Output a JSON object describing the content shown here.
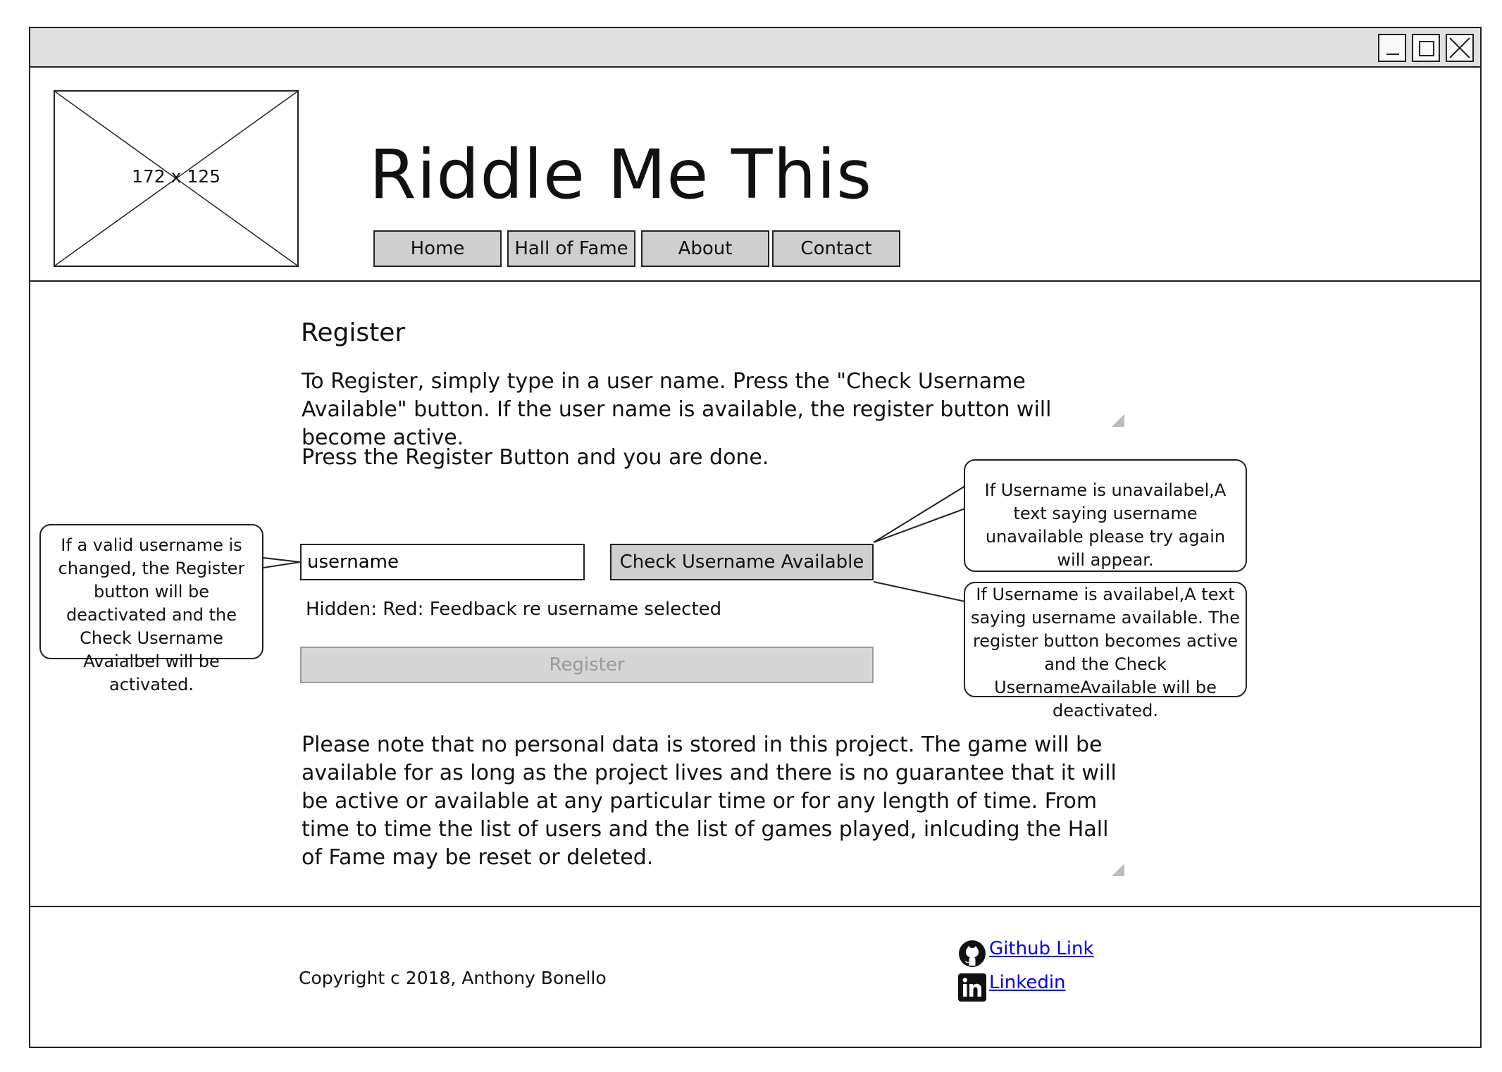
{
  "window": {
    "controls": {
      "minimize_icon": "minimize-icon",
      "maximize_icon": "maximize-icon",
      "close_icon": "close-icon"
    }
  },
  "header": {
    "logo_placeholder": "172 x 125",
    "title": "Riddle Me This",
    "nav": [
      {
        "label": "Home"
      },
      {
        "label": "Hall of Fame"
      },
      {
        "label": "About"
      },
      {
        "label": "Contact"
      }
    ]
  },
  "main": {
    "heading": "Register",
    "intro_1": "To Register, simply type in a user name. Press the \"Check Username Available\" button. If the user name is available, the register button will become active.",
    "intro_2": "Press the Register Button and you are done.",
    "username_value": "username",
    "check_button": "Check Username Available",
    "feedback": "Hidden: Red: Feedback re username selected",
    "register_button": "Register",
    "notice": "Please note that no personal data is stored in this project. The game will be available for as long as the project lives and there is no guarantee that it will be active or available at any particular time or for any length of time. From time to time the list of users and the list of games played, inlcuding the Hall of Fame may be reset or deleted."
  },
  "callouts": {
    "left": "If a valid username is changed, the Register button will be deactivated and the Check Username Avaialbel will be activated.",
    "right_top": "If Username is unavailabel,A text saying username unavailable please try again will appear.",
    "right_bottom": "If Username is availabel,A text saying username available. The register button becomes active and the Check UsernameAvailable will be deactivated."
  },
  "footer": {
    "copyright": "Copyright c 2018, Anthony Bonello",
    "github": {
      "label": "Github Link",
      "icon": "github-icon"
    },
    "linkedin": {
      "label": "Linkedin",
      "icon": "linkedin-icon"
    }
  },
  "colors": {
    "button_bg": "#cfcfcf",
    "disabled_text": "#9a9a9a",
    "link": "#0000ee",
    "titlebar": "#e0e0e0"
  }
}
